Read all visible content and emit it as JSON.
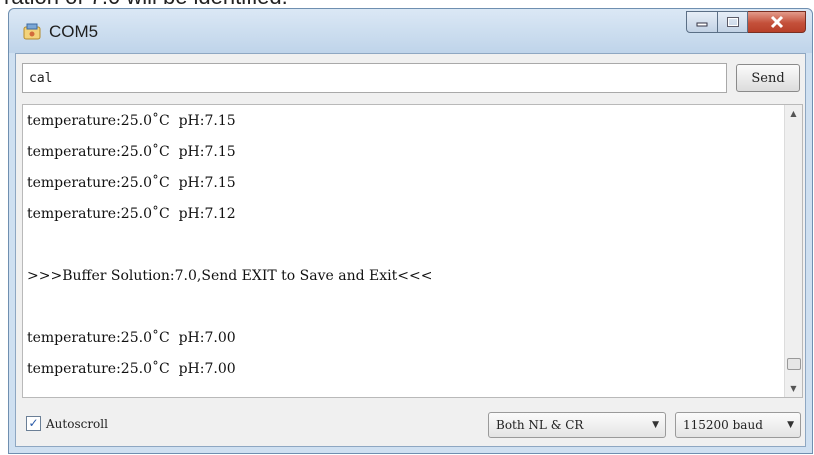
{
  "caption_fragment": "ration of 7.0 will be identified.",
  "window": {
    "title": "COM5",
    "icon": "serial-monitor-app-icon",
    "controls": {
      "minimize": "minimize-icon",
      "maximize": "maximize-icon",
      "close": "close-icon"
    }
  },
  "input": {
    "value": "cal",
    "send_label": "Send"
  },
  "output": {
    "lines": [
      "temperature:25.0˚C  pH:7.15",
      "temperature:25.0˚C  pH:7.15",
      "temperature:25.0˚C  pH:7.15",
      "temperature:25.0˚C  pH:7.12",
      "",
      ">>>Buffer Solution:7.0,Send EXIT to Save and Exit<<<",
      "",
      "temperature:25.0˚C  pH:7.00",
      "temperature:25.0˚C  pH:7.00"
    ]
  },
  "footer": {
    "autoscroll_label": "Autoscroll",
    "autoscroll_checked": true,
    "line_ending": "Both NL & CR",
    "baud": "115200 baud"
  },
  "colors": {
    "titlebar": "#c6d9ee",
    "close_button": "#c4503a",
    "client_bg": "#f0f0f0"
  }
}
